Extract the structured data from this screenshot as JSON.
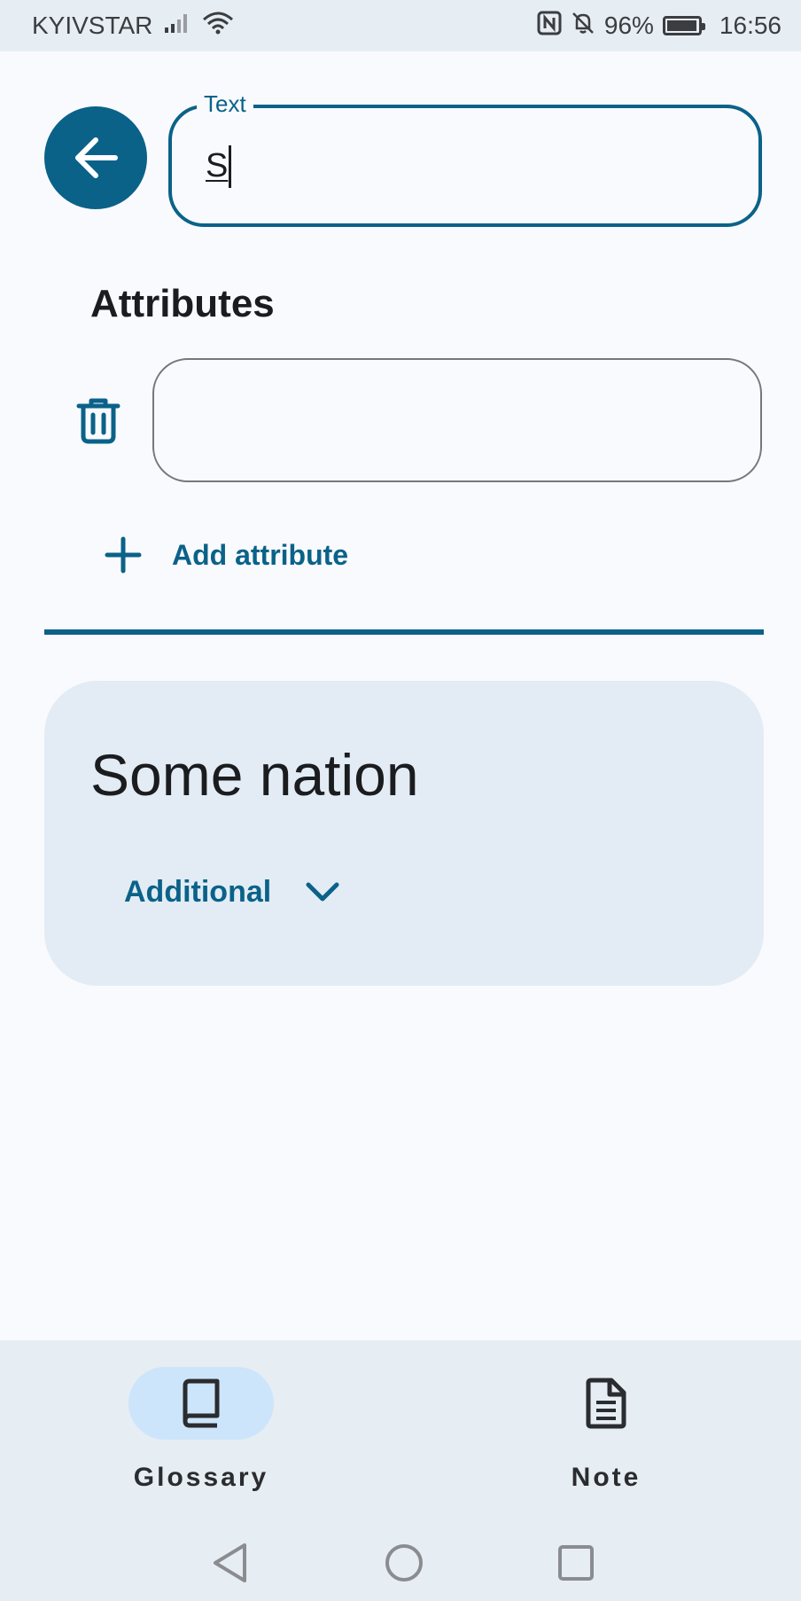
{
  "status_bar": {
    "carrier": "KYIVSTAR",
    "battery_percent": "96%",
    "time": "16:56"
  },
  "header": {
    "text_field_label": "Text",
    "text_field_value": "S"
  },
  "attributes": {
    "title": "Attributes",
    "items": [
      {
        "value": ""
      }
    ],
    "add_label": "Add attribute"
  },
  "card": {
    "title": "Some nation",
    "toggle_label": "Additional"
  },
  "bottom_nav": {
    "items": [
      {
        "label": "Glossary",
        "icon": "book-icon",
        "active": true
      },
      {
        "label": "Note",
        "icon": "note-icon",
        "active": false
      }
    ]
  },
  "colors": {
    "primary": "#0a6289",
    "background": "#f9fafd",
    "surface": "#e3ecf4",
    "nav_active": "#cde5fb"
  }
}
